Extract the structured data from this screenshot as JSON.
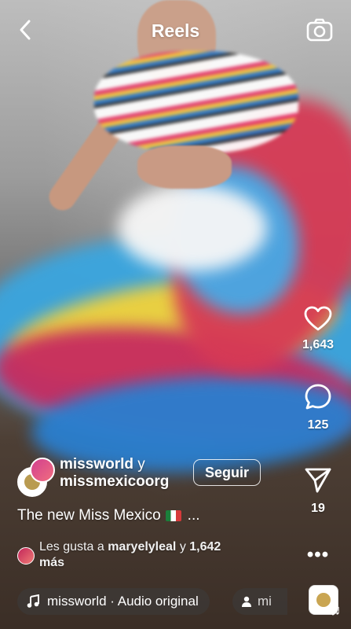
{
  "top_bar": {
    "title": "Reels"
  },
  "author": {
    "user1": "missworld",
    "connector": "y",
    "user2": "missmexicoorg",
    "follow_label": "Seguir"
  },
  "caption": {
    "text": "The new Miss Mexico",
    "more": "..."
  },
  "likes": {
    "prefix": "Les gusta a",
    "user": "maryelyleal",
    "middle": "y",
    "count": "1,642",
    "suffix": "más"
  },
  "audio": {
    "text": "missworld · Audio original",
    "chip_text": "mi"
  },
  "actions": {
    "likes": "1,643",
    "comments": "125",
    "shares": "19"
  },
  "icons": [
    "back-icon",
    "camera-icon",
    "heart-icon",
    "comment-icon",
    "share-icon",
    "more-icon",
    "music-note-icon",
    "person-icon"
  ]
}
